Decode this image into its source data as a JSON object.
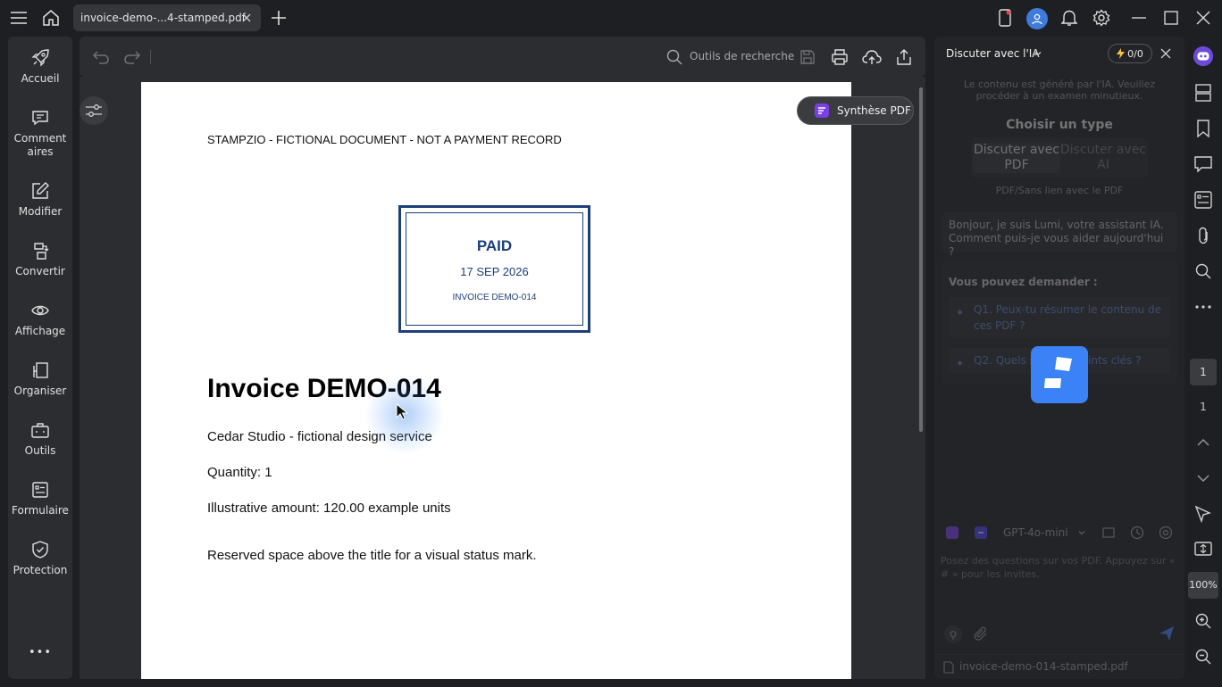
{
  "titlebar": {
    "tab_title": "invoice-demo-...4-stamped.pdf"
  },
  "leftnav": {
    "items": [
      {
        "label": "Accueil",
        "icon": "rocket-icon"
      },
      {
        "label": "Commentaires",
        "icon": "comment-icon"
      },
      {
        "label": "Modifier",
        "icon": "edit-icon"
      },
      {
        "label": "Convertir",
        "icon": "convert-icon"
      },
      {
        "label": "Affichage",
        "icon": "eye-icon"
      },
      {
        "label": "Organiser",
        "icon": "organize-icon"
      },
      {
        "label": "Outils",
        "icon": "toolbox-icon"
      },
      {
        "label": "Formulaire",
        "icon": "form-icon"
      },
      {
        "label": "Protection",
        "icon": "shield-icon"
      }
    ],
    "more": "•••"
  },
  "toolbar": {
    "search_label": "Outils de recherche"
  },
  "document": {
    "header_line": "STAMPZIO - FICTIONAL DOCUMENT - NOT A PAYMENT RECORD",
    "stamp": {
      "status": "PAID",
      "date": "17 SEP 2026",
      "ref": "INVOICE DEMO-014",
      "color": "#1c3f7a"
    },
    "title": "Invoice DEMO-014",
    "line1": "Cedar Studio - fictional design service",
    "line2": "Quantity: 1",
    "line3": "Illustrative amount: 120.00 example units",
    "line4": "Reserved space above the title for a visual status mark."
  },
  "synthese_button": "Synthèse PDF",
  "ai_panel": {
    "title": "Discuter avec l'IA",
    "quota": "0/0",
    "note": "Le contenu est généré par l'IA. Veuillez procéder à un examen minutieux.",
    "choose_type": "Choisir un type",
    "type_pdf": "Discuter avec PDF",
    "type_ai": "Discuter avec AI",
    "type_sub": "PDF/Sans lien avec le PDF",
    "greeting": "Bonjour, je suis Lumi, votre assistant IA. Comment puis-je vous aider aujourd'hui ?",
    "suggest_title": "Vous pouvez demander :",
    "q1": "Q1. Peux-tu résumer le contenu de ces PDF ?",
    "q2": "Q2. Quels sont les points clés ?",
    "model": "GPT-4o-mini",
    "input_placeholder": "Posez des questions sur vos PDF. Appuyez sur « # » pour les invites.",
    "file_name": "invoice-demo-014-stamped.pdf",
    "accent": "#3b82f6"
  },
  "rightrail": {
    "page_current": "1",
    "page_total": "1",
    "zoom": "100%"
  }
}
